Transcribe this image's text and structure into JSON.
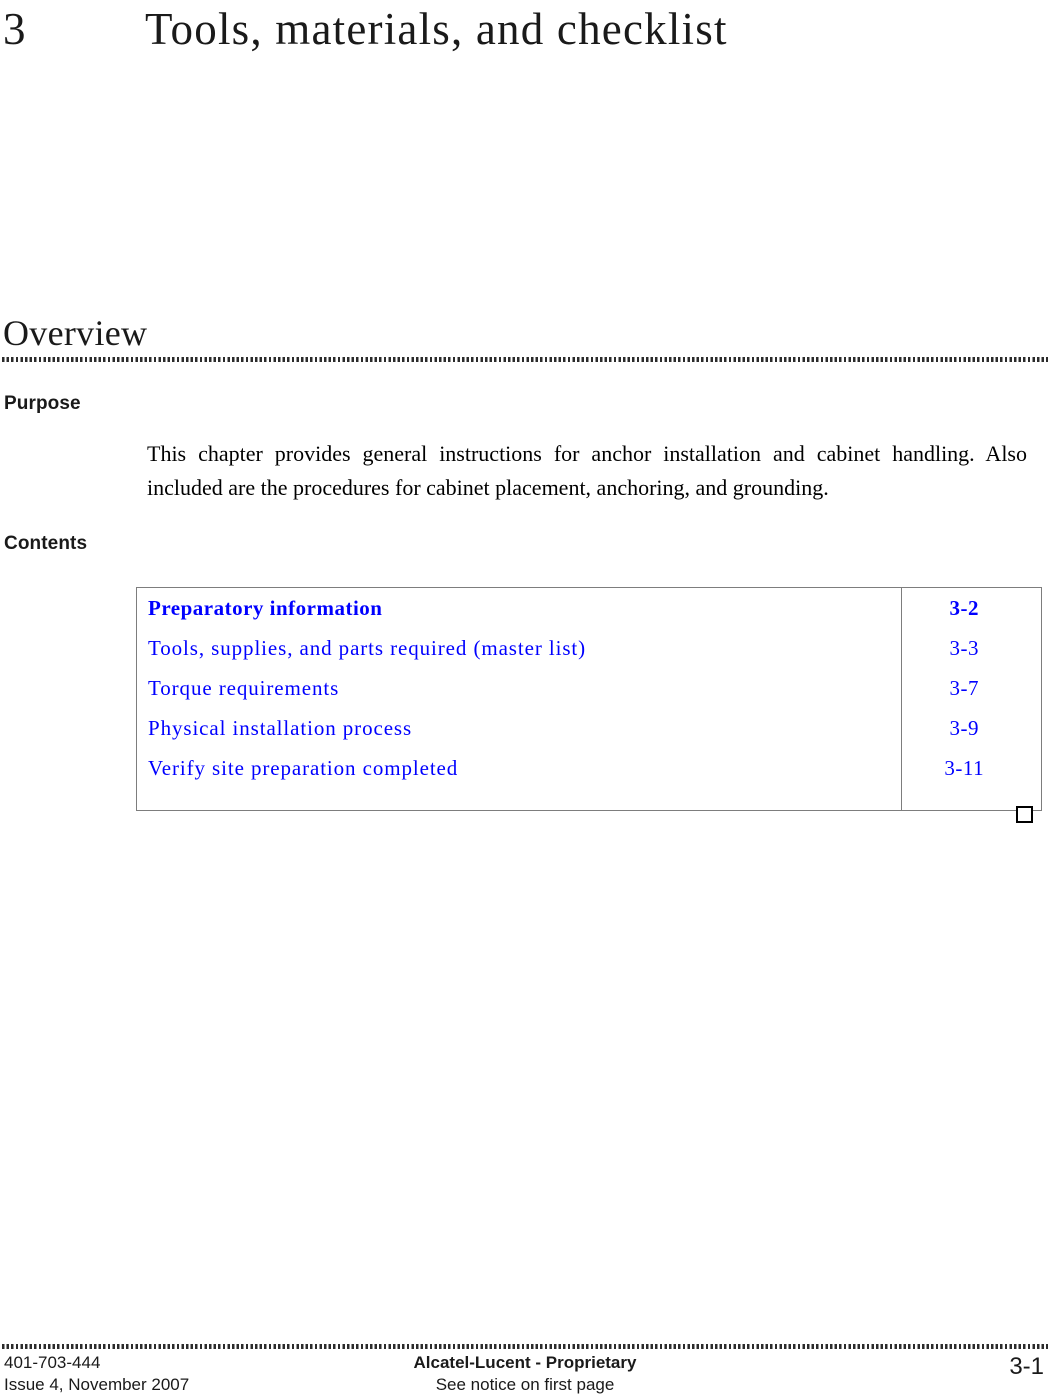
{
  "chapter": {
    "number": "3",
    "title": "Tools, materials, and checklist"
  },
  "section": {
    "heading": "Overview"
  },
  "purpose": {
    "label": "Purpose",
    "text": "This chapter provides general instructions for anchor installation and cabinet handling. Also included are the procedures for cabinet placement, anchoring, and grounding."
  },
  "contents": {
    "label": "Contents",
    "link_color": "#0000ff",
    "border_color": "#7d7d7d",
    "rows": [
      {
        "entry": "Preparatory information",
        "page": "3-2",
        "bold": true
      },
      {
        "entry": "Tools, supplies, and parts required (master list)",
        "page": "3-3",
        "bold": false
      },
      {
        "entry": "Torque requirements",
        "page": "3-7",
        "bold": false
      },
      {
        "entry": "Physical installation process",
        "page": "3-9",
        "bold": false
      },
      {
        "entry": "Verify site preparation completed",
        "page": "3-11",
        "bold": false
      }
    ]
  },
  "footer": {
    "doc_number": "401-703-444",
    "issue": "Issue 4, November 2007",
    "proprietary": "Alcatel-Lucent - Proprietary",
    "notice": "See notice on first page",
    "page_number": "3-1"
  }
}
